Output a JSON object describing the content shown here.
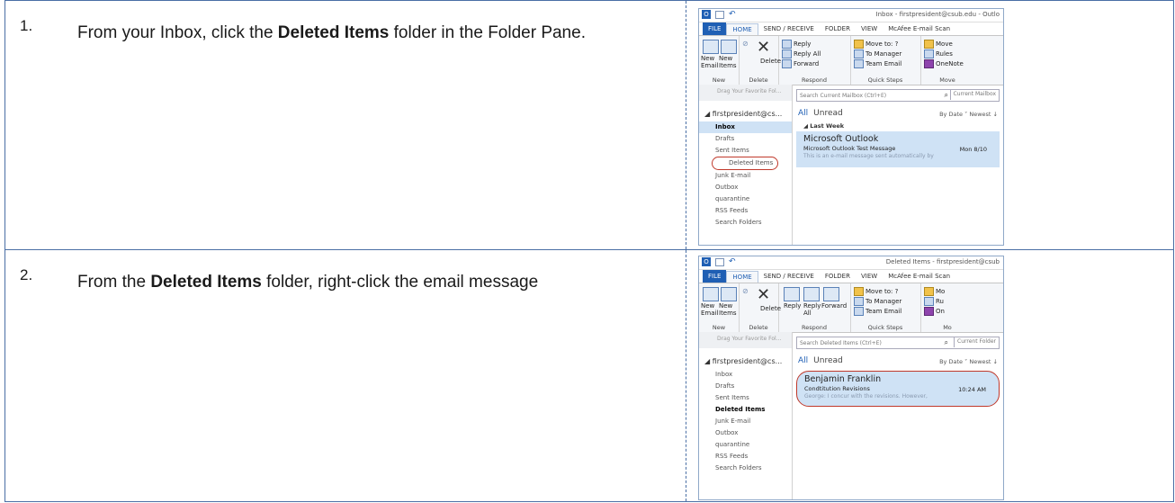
{
  "steps": [
    {
      "number": "1.",
      "text_before": "From your Inbox, click the ",
      "bold": "Deleted Items",
      "text_after": " folder in the Folder Pane.",
      "screenshot": {
        "window_title": "Inbox - firstpresident@csub.edu - Outlo",
        "tabs": [
          "FILE",
          "HOME",
          "SEND / RECEIVE",
          "FOLDER",
          "VIEW",
          "McAfee E-mail Scan"
        ],
        "ribbon": {
          "new_email": "New\nEmail",
          "new_items": "New\nItems",
          "delete": "Delete",
          "reply": "Reply",
          "reply_all": "Reply All",
          "forward": "Forward",
          "move_to": "Move to: ?",
          "to_manager": "To Manager",
          "team_email": "Team Email",
          "move": "Move",
          "rules": "Rules",
          "onenote": "OneNote",
          "groups": [
            "New",
            "Delete",
            "Respond",
            "Quick Steps",
            "Move"
          ]
        },
        "drag_hint": "Drag Your Favorite Fol...",
        "account": "◢ firstpresident@cs...",
        "folders": [
          "Inbox",
          "Drafts",
          "Sent Items",
          "Deleted Items",
          "Junk E-mail",
          "Outbox",
          "quarantine",
          "RSS Feeds",
          "Search Folders"
        ],
        "search_placeholder": "Search Current Mailbox (Ctrl+E)",
        "search_scope": "Current Mailbox",
        "filter_all": "All",
        "filter_unread": "Unread",
        "sort": "By Date ˅  Newest ↓",
        "group_header": "◢ Last Week",
        "message": {
          "sender": "Microsoft Outlook",
          "subject": "Microsoft Outlook Test Message",
          "preview": "This is an e-mail message sent automatically by",
          "date": "Mon 8/10"
        }
      }
    },
    {
      "number": "2.",
      "text_before": "From the ",
      "bold": "Deleted Items",
      "text_after": " folder, right-click the  email message",
      "screenshot": {
        "window_title": "Deleted Items - firstpresident@csub",
        "tabs": [
          "FILE",
          "HOME",
          "SEND / RECEIVE",
          "FOLDER",
          "VIEW",
          "McAfee E-mail Scan"
        ],
        "ribbon": {
          "new_email": "New\nEmail",
          "new_items": "New\nItems",
          "delete": "Delete",
          "reply": "Reply",
          "reply_all": "Reply\nAll",
          "forward": "Forward",
          "move_to": "Move to: ?",
          "to_manager": "To Manager",
          "team_email": "Team Email",
          "move": "Mo",
          "rules": "Ru",
          "onenote": "On",
          "groups": [
            "New",
            "Delete",
            "Respond",
            "Quick Steps",
            "Mo"
          ]
        },
        "drag_hint": "Drag Your Favorite Fol...",
        "account": "◢ firstpresident@cs...",
        "folders": [
          "Inbox",
          "Drafts",
          "Sent Items",
          "Deleted Items",
          "Junk E-mail",
          "Outbox",
          "quarantine",
          "RSS Feeds",
          "Search Folders"
        ],
        "search_placeholder": "Search Deleted Items (Ctrl+E)",
        "search_scope": "Current Folder",
        "filter_all": "All",
        "filter_unread": "Unread",
        "sort": "By Date ˅  Newest ↓",
        "group_header": "",
        "message": {
          "sender": "Benjamin Franklin",
          "subject": "Condtitution Revisions",
          "preview": "George:  I concur with the revisions.  However,",
          "date": "10:24 AM"
        }
      }
    }
  ]
}
